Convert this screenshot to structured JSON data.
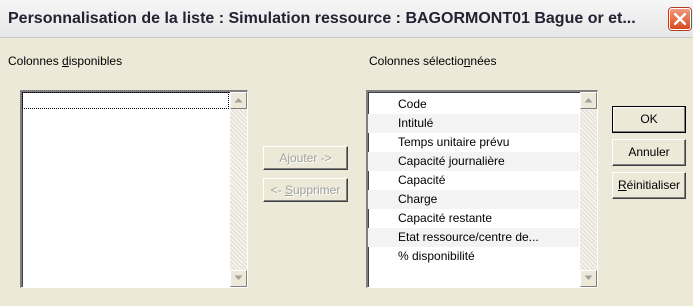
{
  "window": {
    "title": "Personnalisation de la liste : Simulation ressource : BAGORMONT01 Bague or et..."
  },
  "available": {
    "label_pre": "Colonnes ",
    "label_accel": "d",
    "label_post": "isponibles",
    "items": []
  },
  "selected": {
    "label_pre": "Colonnes sélectio",
    "label_accel": "n",
    "label_post": "nées",
    "items": [
      "Code",
      "Intitulé",
      "Temps unitaire prévu",
      "Capacité journalière",
      "Capacité",
      "Charge",
      "Capacité restante",
      "Etat ressource/centre de...",
      "% disponibilité"
    ]
  },
  "buttons": {
    "add": "Ajouter ->",
    "remove_pre": "<- ",
    "remove_accel": "S",
    "remove_post": "upprimer",
    "ok": "OK",
    "cancel": "Annuler",
    "reset_accel": "R",
    "reset_post": "éinitialiser"
  },
  "icons": {
    "close": "close-x-icon",
    "scroll_up": "arrow-up-icon",
    "scroll_down": "arrow-down-icon"
  }
}
